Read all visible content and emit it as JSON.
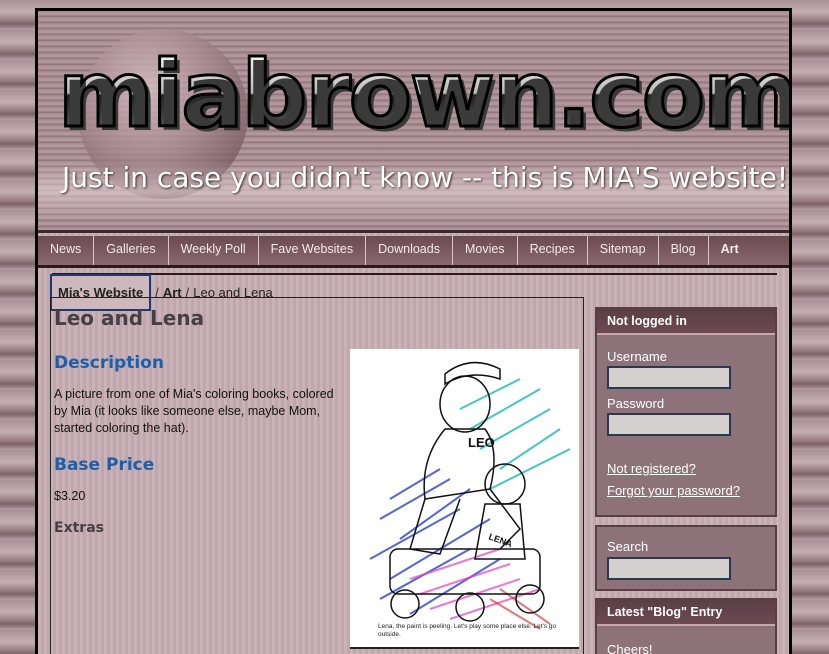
{
  "header": {
    "logo": "miabrown.com",
    "tagline": "Just in case you didn't know --  this is MIA'S website!"
  },
  "nav": {
    "items": [
      {
        "label": "News"
      },
      {
        "label": "Galleries"
      },
      {
        "label": "Weekly Poll"
      },
      {
        "label": "Fave Websites"
      },
      {
        "label": "Downloads"
      },
      {
        "label": "Movies"
      },
      {
        "label": "Recipes"
      },
      {
        "label": "Sitemap"
      },
      {
        "label": "Blog"
      },
      {
        "label": "Art"
      }
    ],
    "active": "Art"
  },
  "breadcrumb": {
    "home": "Mia's Website",
    "sep1": "/",
    "section": "Art",
    "sep2": "/",
    "current": "Leo and Lena"
  },
  "item": {
    "title": "Leo and Lena",
    "description_heading": "Description",
    "description": "A picture from one of Mia's coloring books, colored by Mia (it looks like someone else, maybe Mom, started coloring the hat).",
    "price_heading": "Base Price",
    "price": "$3.20",
    "extras_heading": "Extras",
    "image_caption": "Lena, the paint is peeling. Let's play some place else. Let's go outside.",
    "image_lettering": [
      "LEO",
      "LENA"
    ]
  },
  "login": {
    "heading": "Not logged in",
    "username_label": "Username",
    "password_label": "Password",
    "register_link": "Not registered?",
    "forgot_link": "Forgot your password?"
  },
  "search": {
    "label": "Search"
  },
  "blog": {
    "heading": "Latest \"Blog\" Entry",
    "entry": "Cheers!"
  },
  "colors": {
    "nav_bg": "#6b4a50",
    "heading_blue": "#1e5fa8",
    "sidebar_bg": "#8d727a"
  }
}
